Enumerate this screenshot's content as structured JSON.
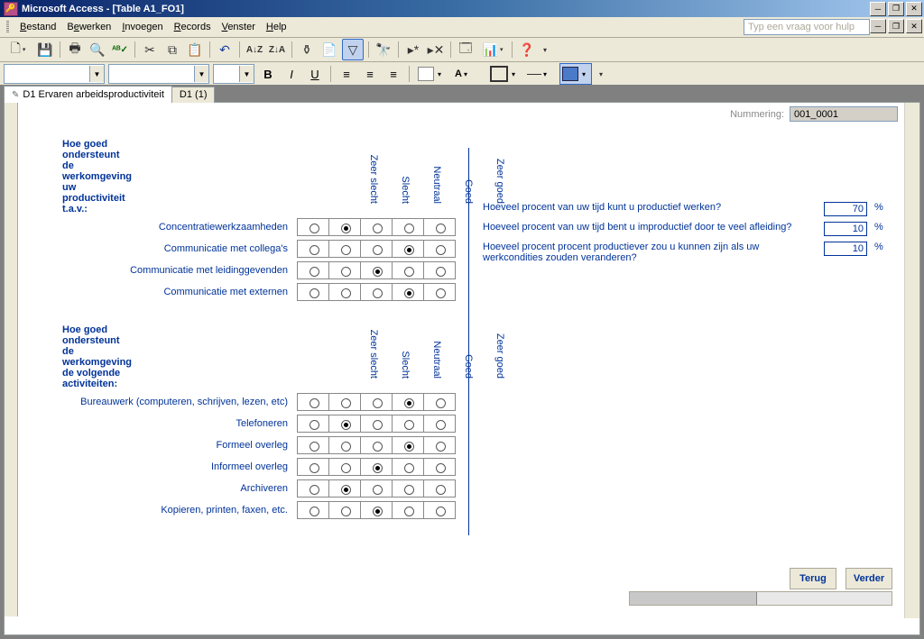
{
  "title": "Microsoft Access - [Table A1_FO1]",
  "menu": {
    "bestand": "Bestand",
    "bewerken": "Bewerken",
    "invoegen": "Invoegen",
    "records": "Records",
    "venster": "Venster",
    "help": "Help"
  },
  "help_placeholder": "Typ een vraag voor hulp",
  "tabs": {
    "active": "D1 Ervaren arbeidsproductiviteit",
    "inactive": "D1 (1)"
  },
  "nummering": {
    "label": "Nummering:",
    "value": "001_0001"
  },
  "headers": {
    "zeer_slecht": "Zeer slecht",
    "slecht": "Slecht",
    "neutraal": "Neutraal",
    "goed": "Goed",
    "zeer_goed": "Zeer goed"
  },
  "block1": {
    "title": "Hoe goed ondersteunt de werkomgeving uw productiviteit t.a.v.:",
    "rows": [
      {
        "label": "Concentratiewerkzaamheden",
        "sel": 1
      },
      {
        "label": "Communicatie met collega's",
        "sel": 3
      },
      {
        "label": "Communicatie met leidinggevenden",
        "sel": 2
      },
      {
        "label": "Communicatie met externen",
        "sel": 3
      }
    ]
  },
  "block2": {
    "title": "Hoe goed ondersteunt de werkomgeving de volgende activiteiten:",
    "rows": [
      {
        "label": "Bureauwerk (computeren, schrijven, lezen, etc)",
        "sel": 3
      },
      {
        "label": "Telefoneren",
        "sel": 1
      },
      {
        "label": "Formeel overleg",
        "sel": 3
      },
      {
        "label": "Informeel overleg",
        "sel": 2
      },
      {
        "label": "Archiveren",
        "sel": 1
      },
      {
        "label": "Kopieren, printen, faxen, etc.",
        "sel": 2
      }
    ]
  },
  "pct": {
    "q1": "Hoeveel procent van uw tijd kunt u productief werken?",
    "v1": "70",
    "q2": "Hoeveel procent van uw tijd bent u improductief door te veel afleiding?",
    "v2": "10",
    "q3": "Hoeveel procent procent productiever zou u kunnen zijn als uw werkcondities zouden veranderen?",
    "v3": "10",
    "sym": "%"
  },
  "buttons": {
    "back": "Terug",
    "next": "Verder"
  }
}
